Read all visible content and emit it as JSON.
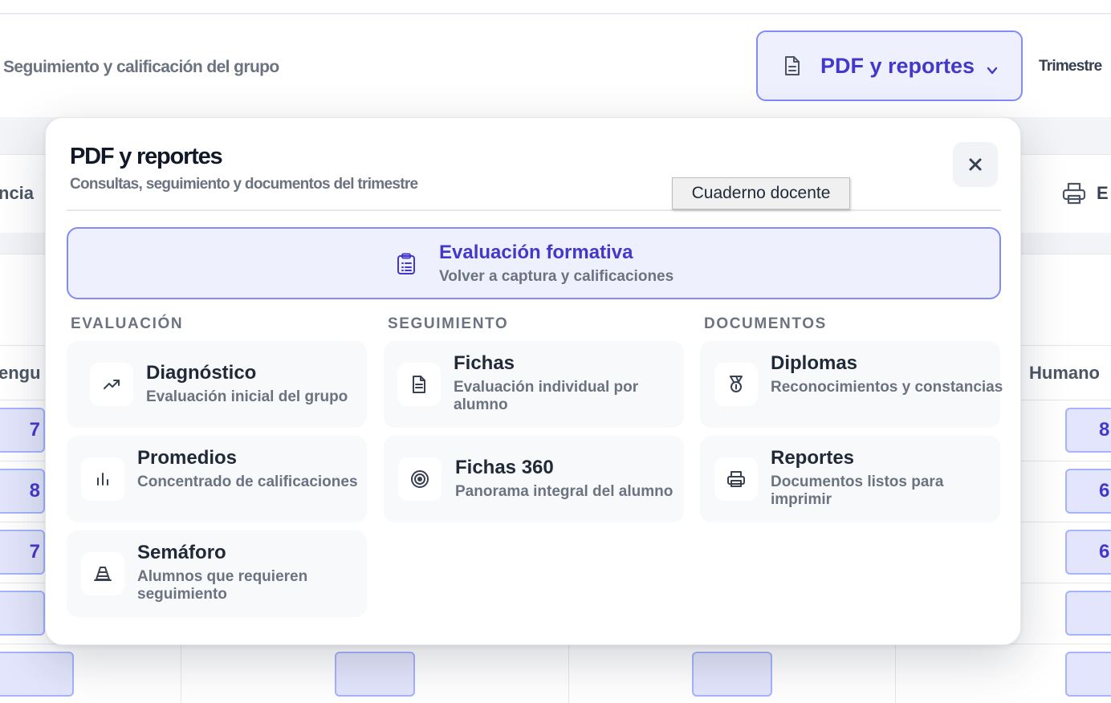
{
  "page": {
    "subtitle": "Seguimiento y calificación del grupo",
    "pdf_button_label": "PDF y reportes",
    "trimestre_label": "Trimestre",
    "bg_labels": {
      "left_header": "ncia",
      "left_row": "engu",
      "right_row": "Humano",
      "right_header": "E"
    },
    "left_cells": [
      "7",
      "8",
      "7",
      "",
      ""
    ],
    "right_cells": [
      "8",
      "6",
      "6",
      "",
      ""
    ]
  },
  "modal": {
    "title": "PDF y reportes",
    "subtitle": "Consultas, seguimiento y documentos del trimestre",
    "close_label": "×",
    "tooltip": "Cuaderno docente",
    "featured": {
      "title": "Evaluación formativa",
      "desc": "Volver a captura y calificaciones"
    },
    "sections": [
      {
        "heading": "EVALUACIÓN",
        "items": [
          {
            "title": "Diagnóstico",
            "desc": "Evaluación inicial del grupo",
            "icon": "trending-up-icon"
          },
          {
            "title": "Promedios",
            "desc": "Concentrado de calificaciones",
            "icon": "bar-chart-icon"
          },
          {
            "title": "Semáforo",
            "desc": "Alumnos que requieren seguimiento",
            "icon": "traffic-cone-icon"
          }
        ]
      },
      {
        "heading": "SEGUIMIENTO",
        "items": [
          {
            "title": "Fichas",
            "desc": "Evaluación individual por alumno",
            "icon": "file-text-icon"
          },
          {
            "title": "Fichas 360",
            "desc": "Panorama integral del alumno",
            "icon": "target-icon"
          }
        ]
      },
      {
        "heading": "DOCUMENTOS",
        "items": [
          {
            "title": "Diplomas",
            "desc": "Reconocimientos y constancias",
            "icon": "medal-icon"
          },
          {
            "title": "Reportes",
            "desc": "Documentos listos para imprimir",
            "icon": "printer-icon"
          }
        ]
      }
    ]
  }
}
